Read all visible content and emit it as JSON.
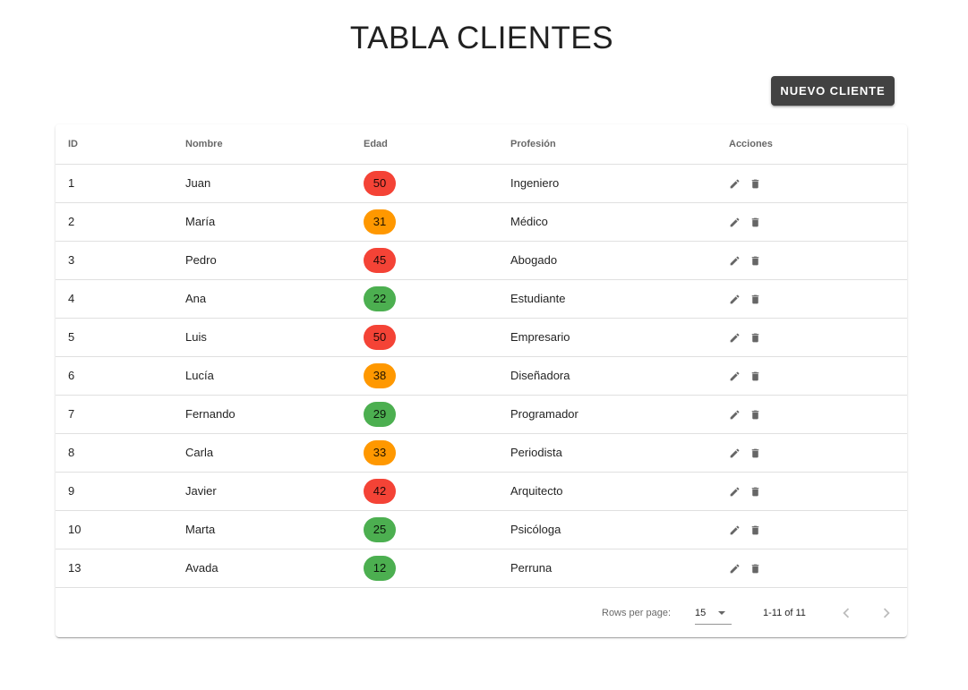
{
  "page": {
    "title": "TABLA CLIENTES",
    "new_button_label": "NUEVO CLIENTE"
  },
  "table": {
    "headers": [
      "ID",
      "Nombre",
      "Edad",
      "Profesión",
      "Acciones"
    ],
    "rows": [
      {
        "id": "1",
        "nombre": "Juan",
        "edad": "50",
        "profesion": "Ingeniero",
        "age_color": "#f44336"
      },
      {
        "id": "2",
        "nombre": "María",
        "edad": "31",
        "profesion": "Médico",
        "age_color": "#ff9800"
      },
      {
        "id": "3",
        "nombre": "Pedro",
        "edad": "45",
        "profesion": "Abogado",
        "age_color": "#f44336"
      },
      {
        "id": "4",
        "nombre": "Ana",
        "edad": "22",
        "profesion": "Estudiante",
        "age_color": "#4caf50"
      },
      {
        "id": "5",
        "nombre": "Luis",
        "edad": "50",
        "profesion": "Empresario",
        "age_color": "#f44336"
      },
      {
        "id": "6",
        "nombre": "Lucía",
        "edad": "38",
        "profesion": "Diseñadora",
        "age_color": "#ff9800"
      },
      {
        "id": "7",
        "nombre": "Fernando",
        "edad": "29",
        "profesion": "Programador",
        "age_color": "#4caf50"
      },
      {
        "id": "8",
        "nombre": "Carla",
        "edad": "33",
        "profesion": "Periodista",
        "age_color": "#ff9800"
      },
      {
        "id": "9",
        "nombre": "Javier",
        "edad": "42",
        "profesion": "Arquitecto",
        "age_color": "#f44336"
      },
      {
        "id": "10",
        "nombre": "Marta",
        "edad": "25",
        "profesion": "Psicóloga",
        "age_color": "#4caf50"
      },
      {
        "id": "13",
        "nombre": "Avada",
        "edad": "12",
        "profesion": "Perruna",
        "age_color": "#4caf50"
      }
    ],
    "actions": [
      "pencil-icon",
      "trash-icon"
    ]
  },
  "pagination": {
    "rows_per_page_label": "Rows per page:",
    "rows_per_page": "15",
    "range_text": "1-11 of 11"
  },
  "colors": {
    "button_bg": "#424242",
    "age_high": "#f44336",
    "age_mid": "#ff9800",
    "age_low": "#4caf50"
  }
}
